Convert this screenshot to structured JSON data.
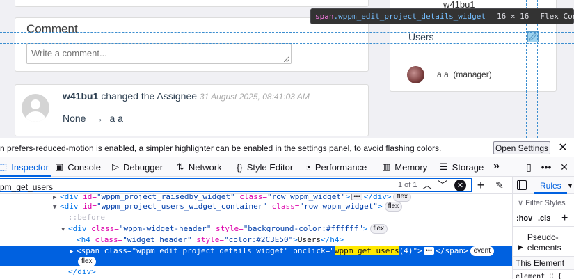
{
  "page": {
    "top_card_user": "w41bu1",
    "comment_title": "Comment",
    "comment_placeholder": "Write a comment...",
    "activity": {
      "user": "w41bu1",
      "action": "changed the Assignee",
      "date": "31 August 2025, 08:41:03 AM",
      "from": "None",
      "arrow": "→",
      "to": "a a"
    },
    "sidebar": {
      "header": "Users",
      "user_name": "a a",
      "user_role": "(manager)"
    }
  },
  "highlighter_tooltip": {
    "tag": "span",
    "class": ".wppm_edit_project_details_widget",
    "dimensions": "16 × 16",
    "type": "Flex Container/Item"
  },
  "devtools": {
    "notice": {
      "text": "n prefers-reduced-motion is enabled, a simpler highlighter can be enabled in the settings panel, to avoid flashing colors.",
      "button": "Open Settings",
      "close": "✕"
    },
    "tabs": [
      {
        "label": "Inspector",
        "icon": "inspector-icon",
        "selected": true
      },
      {
        "label": "Console",
        "icon": "console-icon"
      },
      {
        "label": "Debugger",
        "icon": "debugger-icon"
      },
      {
        "label": "Network",
        "icon": "network-icon"
      },
      {
        "label": "Style Editor",
        "icon": "style-editor-icon"
      },
      {
        "label": "Performance",
        "icon": "performance-icon"
      },
      {
        "label": "Memory",
        "icon": "memory-icon"
      },
      {
        "label": "Storage",
        "icon": "storage-icon"
      }
    ],
    "search": {
      "value": "pm_get_users",
      "count": "1 of 1"
    },
    "markup": {
      "line1": {
        "tag_open": "<div ",
        "attr1": "id=",
        "val1": "\"wppm_project_raisedby_widget\"",
        "attr2": " class=",
        "val2": "\"row wppm_widget\"",
        "tag_close": ">",
        "after": "</div>",
        "badge": "flex"
      },
      "line2": {
        "tag_open": "<div ",
        "attr1": "id=",
        "val1": "\"wppm_project_users_widget_container\"",
        "attr2": " class=",
        "val2": "\"row wppm_widget\"",
        "tag_close": ">",
        "badge": "flex"
      },
      "line3": {
        "text": "::before"
      },
      "line4": {
        "tag_open": "<div ",
        "attr1": "class=",
        "val1": "\"wppm-widget-header\"",
        "attr2": " style=",
        "val2": "\"background-color:#ffffff\"",
        "tag_close": ">",
        "badge": "flex"
      },
      "line5": {
        "tag_open": "<h4 ",
        "attr1": "class=",
        "val1": "\"widget_header\"",
        "attr2": " style=",
        "val2": "\"color:#2C3E50\"",
        "tag_close": ">",
        "text": "Users",
        "end": "</h4>"
      },
      "line6": {
        "tag_open": "<span ",
        "attr1": "class=",
        "val1": "\"wppm_edit_project_details_widget\"",
        "attr2": " onclick=",
        "val2a": "\"",
        "hl": "wppm_get_users",
        "val2b": "(4)\"",
        "tag_close": ">",
        "end": "</span>",
        "badge1": "event",
        "badge2": "flex"
      },
      "line7": {
        "text": "</div>"
      }
    },
    "rules": {
      "tab": "Rules",
      "filter_placeholder": "Filter Styles",
      "hov": ":hov",
      "cls": ".cls",
      "pseudo_elements": "Pseudo-elements",
      "this_element": "This Element",
      "element_rule": "element ⁝⁝ {"
    }
  },
  "colors": {
    "accent": "#0061e0",
    "highlight": "#ffe900",
    "guide": "#3b8ed0",
    "heading": "#2c3e50"
  }
}
